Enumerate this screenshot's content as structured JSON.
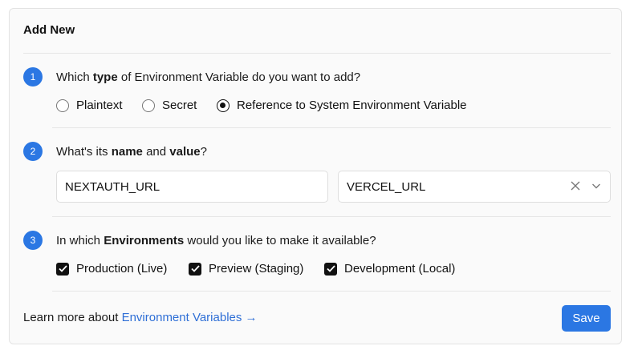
{
  "card": {
    "title": "Add New"
  },
  "step1": {
    "number": "1",
    "question_pre": "Which ",
    "question_bold": "type",
    "question_post": " of Environment Variable do you want to add?",
    "options": [
      {
        "label": "Plaintext",
        "checked": false
      },
      {
        "label": "Secret",
        "checked": false
      },
      {
        "label": "Reference to System Environment Variable",
        "checked": true
      }
    ]
  },
  "step2": {
    "number": "2",
    "question_pre": "What's its ",
    "question_bold1": "name",
    "question_mid": " and ",
    "question_bold2": "value",
    "question_post": "?",
    "name_value": "NEXTAUTH_URL",
    "value_selected": "VERCEL_URL"
  },
  "step3": {
    "number": "3",
    "question_pre": "In which ",
    "question_bold": "Environments",
    "question_post": " would you like to make it available?",
    "options": [
      {
        "label": "Production (Live)",
        "checked": true
      },
      {
        "label": "Preview (Staging)",
        "checked": true
      },
      {
        "label": "Development (Local)",
        "checked": true
      }
    ]
  },
  "footer": {
    "text": "Learn more about ",
    "link_label": "Environment Variables →",
    "save_label": "Save"
  },
  "colors": {
    "accent": "#2b77e3",
    "link": "#2f6fd6"
  }
}
